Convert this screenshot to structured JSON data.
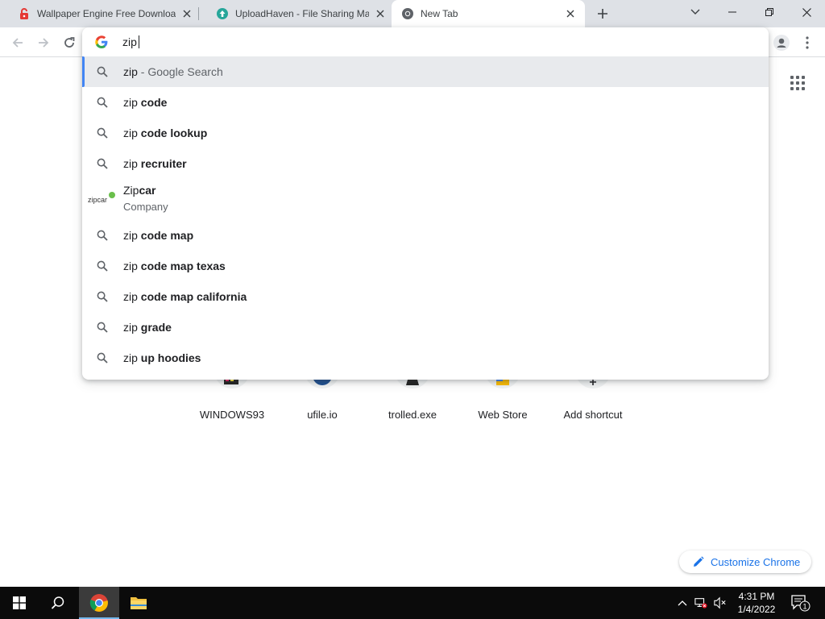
{
  "tabs": [
    {
      "title": "Wallpaper Engine Free Download",
      "favicon": "lock-red-icon"
    },
    {
      "title": "UploadHaven - File Sharing Made",
      "favicon": "uploadhaven-icon"
    },
    {
      "title": "New Tab",
      "favicon": "chrome-icon",
      "active": true
    }
  ],
  "omnibox": {
    "value": "zip",
    "suggestions": [
      {
        "prefix": "zip",
        "rest": " - Google Search",
        "style": "light"
      },
      {
        "prefix": "zip ",
        "rest": "code"
      },
      {
        "prefix": "zip ",
        "rest": "code lookup"
      },
      {
        "prefix": "zip ",
        "rest": "recruiter"
      },
      {
        "prefix": "zip ",
        "rest": "code map"
      },
      {
        "prefix": "zip ",
        "rest": "code map texas"
      },
      {
        "prefix": "zip ",
        "rest": "code map california"
      },
      {
        "prefix": "zip ",
        "rest": "grade"
      },
      {
        "prefix": "zip ",
        "rest": "up hoodies"
      }
    ],
    "entity": {
      "prefix": "Zip",
      "rest": "car",
      "subtitle": "Company",
      "logo_text": "zipcar"
    }
  },
  "shortcuts": [
    {
      "label": "WINDOWS93"
    },
    {
      "label": "ufile.io"
    },
    {
      "label": "trolled.exe"
    },
    {
      "label": "Web Store"
    },
    {
      "label": "Add shortcut"
    }
  ],
  "customize": {
    "label": "Customize Chrome"
  },
  "taskbar": {
    "time": "4:31 PM",
    "date": "1/4/2022",
    "notification_count": "1"
  },
  "colors": {
    "accent": "#1a73e8",
    "selection_bar": "#4285f4",
    "tabstrip": "#dee1e6",
    "taskbar": "#0b0b0b"
  }
}
